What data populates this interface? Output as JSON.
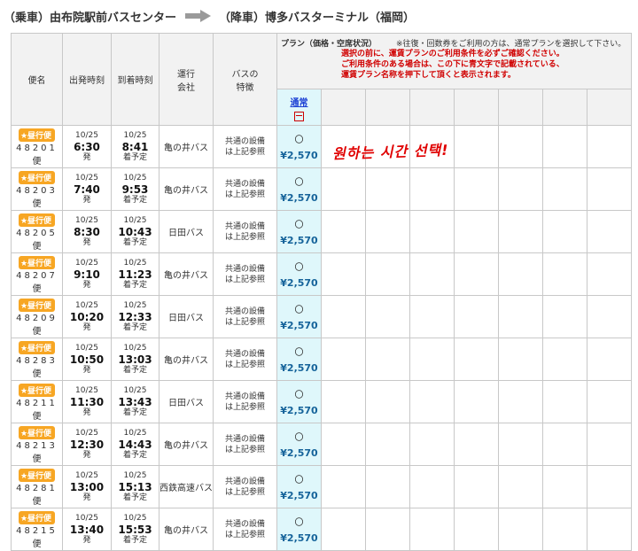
{
  "route": {
    "board_label": "（乗車）",
    "board_stop": "由布院駅前バスセンター",
    "alight_label": "（降車）",
    "alight_stop": "博多バスターミナル（福岡）"
  },
  "headers": {
    "bin": "便名",
    "depart": "出発時刻",
    "arrive": "到着時刻",
    "operator_l1": "運行",
    "operator_l2": "会社",
    "features_l1": "バスの",
    "features_l2": "特徴",
    "plan_label": "プラン（価格・空席状況）",
    "plan_note": "※往復・回数券をご利用の方は、通常プランを選択して下さい。",
    "red_notes": [
      "選択の前に、運賃プランのご利用条件を必ずご確認ください。",
      "ご利用条件のある場合は、この下に青文字で記載されている、",
      "運賃プラン名称を押下して頂くと表示されます。"
    ],
    "plan_name": "通常"
  },
  "annotation": "원하는 시간 선택!",
  "rows": [
    {
      "badge": "★昼行便",
      "bin": "48201",
      "unit": "便",
      "dep_date": "10/25",
      "dep_time": "6:30",
      "dep_suffix": "発",
      "arr_date": "10/25",
      "arr_time": "8:41",
      "arr_suffix": "着予定",
      "operator": "亀の井バス",
      "feat1": "共通の設備",
      "feat2": "は上記参照",
      "avail": "〇",
      "price": "¥2,570"
    },
    {
      "badge": "★昼行便",
      "bin": "48203",
      "unit": "便",
      "dep_date": "10/25",
      "dep_time": "7:40",
      "dep_suffix": "発",
      "arr_date": "10/25",
      "arr_time": "9:53",
      "arr_suffix": "着予定",
      "operator": "亀の井バス",
      "feat1": "共通の設備",
      "feat2": "は上記参照",
      "avail": "〇",
      "price": "¥2,570"
    },
    {
      "badge": "★昼行便",
      "bin": "48205",
      "unit": "便",
      "dep_date": "10/25",
      "dep_time": "8:30",
      "dep_suffix": "発",
      "arr_date": "10/25",
      "arr_time": "10:43",
      "arr_suffix": "着予定",
      "operator": "日田バス",
      "feat1": "共通の設備",
      "feat2": "は上記参照",
      "avail": "〇",
      "price": "¥2,570"
    },
    {
      "badge": "★昼行便",
      "bin": "48207",
      "unit": "便",
      "dep_date": "10/25",
      "dep_time": "9:10",
      "dep_suffix": "発",
      "arr_date": "10/25",
      "arr_time": "11:23",
      "arr_suffix": "着予定",
      "operator": "亀の井バス",
      "feat1": "共通の設備",
      "feat2": "は上記参照",
      "avail": "〇",
      "price": "¥2,570"
    },
    {
      "badge": "★昼行便",
      "bin": "48209",
      "unit": "便",
      "dep_date": "10/25",
      "dep_time": "10:20",
      "dep_suffix": "発",
      "arr_date": "10/25",
      "arr_time": "12:33",
      "arr_suffix": "着予定",
      "operator": "日田バス",
      "feat1": "共通の設備",
      "feat2": "は上記参照",
      "avail": "〇",
      "price": "¥2,570"
    },
    {
      "badge": "★昼行便",
      "bin": "48283",
      "unit": "便",
      "dep_date": "10/25",
      "dep_time": "10:50",
      "dep_suffix": "発",
      "arr_date": "10/25",
      "arr_time": "13:03",
      "arr_suffix": "着予定",
      "operator": "亀の井バス",
      "feat1": "共通の設備",
      "feat2": "は上記参照",
      "avail": "〇",
      "price": "¥2,570"
    },
    {
      "badge": "★昼行便",
      "bin": "48211",
      "unit": "便",
      "dep_date": "10/25",
      "dep_time": "11:30",
      "dep_suffix": "発",
      "arr_date": "10/25",
      "arr_time": "13:43",
      "arr_suffix": "着予定",
      "operator": "日田バス",
      "feat1": "共通の設備",
      "feat2": "は上記参照",
      "avail": "〇",
      "price": "¥2,570"
    },
    {
      "badge": "★昼行便",
      "bin": "48213",
      "unit": "便",
      "dep_date": "10/25",
      "dep_time": "12:30",
      "dep_suffix": "発",
      "arr_date": "10/25",
      "arr_time": "14:43",
      "arr_suffix": "着予定",
      "operator": "亀の井バス",
      "feat1": "共通の設備",
      "feat2": "は上記参照",
      "avail": "〇",
      "price": "¥2,570"
    },
    {
      "badge": "★昼行便",
      "bin": "48281",
      "unit": "便",
      "dep_date": "10/25",
      "dep_time": "13:00",
      "dep_suffix": "発",
      "arr_date": "10/25",
      "arr_time": "15:13",
      "arr_suffix": "着予定",
      "operator": "西鉄高速バス",
      "feat1": "共通の設備",
      "feat2": "は上記参照",
      "avail": "〇",
      "price": "¥2,570"
    },
    {
      "badge": "★昼行便",
      "bin": "48215",
      "unit": "便",
      "dep_date": "10/25",
      "dep_time": "13:40",
      "dep_suffix": "発",
      "arr_date": "10/25",
      "arr_time": "15:53",
      "arr_suffix": "着予定",
      "operator": "亀の井バス",
      "feat1": "共通の設備",
      "feat2": "は上記参照",
      "avail": "〇",
      "price": "¥2,570"
    }
  ]
}
